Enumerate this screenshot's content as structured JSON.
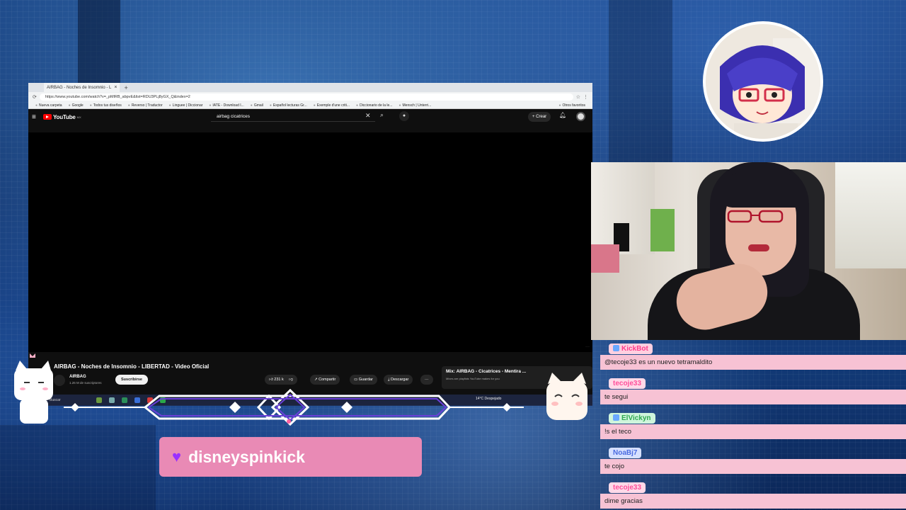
{
  "browser": {
    "tab_title": "AIRBAG - Noches de Insomnio - L",
    "url": "https://www.youtube.com/watch?v=_pMlRB_abpvE&list=RDU3PLj8yGX_Q&index=2",
    "bookmarks": [
      "Nueva carpeta",
      "Google",
      "Todos tus diseños",
      "Reverso | Traductor",
      "Linguee | Diccionar",
      "IATE - Download I...",
      "Gmail",
      "Español lecturas Gr...",
      "Exemple d'une criti...",
      "Diccionario de la le...",
      "Mensch | Unterri..."
    ],
    "other_bookmarks": "Otros favoritos"
  },
  "youtube": {
    "logo": "YouTube",
    "logo_region": "MX",
    "search_query": "airbag cicatrices",
    "create_label": "Crear",
    "video_title": "AIRBAG - Noches de Insomnio - LIBERTAD - Video Oficial",
    "channel_name": "AIRBAG",
    "subscriber_count": "1.26 M de suscriptores",
    "subscribe_label": "Suscribirse",
    "likes": "231 k",
    "share_label": "Compartir",
    "save_label": "Guardar",
    "download_label": "Descargar",
    "more_label": "···",
    "mix_title": "Mix: AIRBAG - Cicatrices - Mentira ...",
    "mix_sub": "Mixes are playlists YouTube makes for you"
  },
  "taskbar": {
    "search_label": "Buscar",
    "weather": "14°C  Despejado"
  },
  "alert": {
    "follower_name": "disneyspinkick"
  },
  "chat": [
    {
      "name": "KickBot",
      "name_color": "#ff3b8a",
      "name_bg": "#ffd0e0",
      "text": "@tecoje33 es un nuevo tetramaldito"
    },
    {
      "name": "tecoje33",
      "name_color": "#ff4f9a",
      "name_bg": "#ffd9e8",
      "text": "te segui"
    },
    {
      "name": "ElVickyn",
      "name_color": "#2fa84f",
      "name_bg": "#cff5dc",
      "text": "!s el teco"
    },
    {
      "name": "NoaBj7",
      "name_color": "#4a6be0",
      "name_bg": "#d6e0ff",
      "text": "te cojo"
    },
    {
      "name": "tecoje33",
      "name_color": "#ff4f9a",
      "name_bg": "#ffd9e8",
      "text": "dime gracias"
    }
  ],
  "colors": {
    "alert_bg": "#e98ab5",
    "chat_bubble": "#f7c2d4",
    "yt_red": "#ff0000"
  }
}
